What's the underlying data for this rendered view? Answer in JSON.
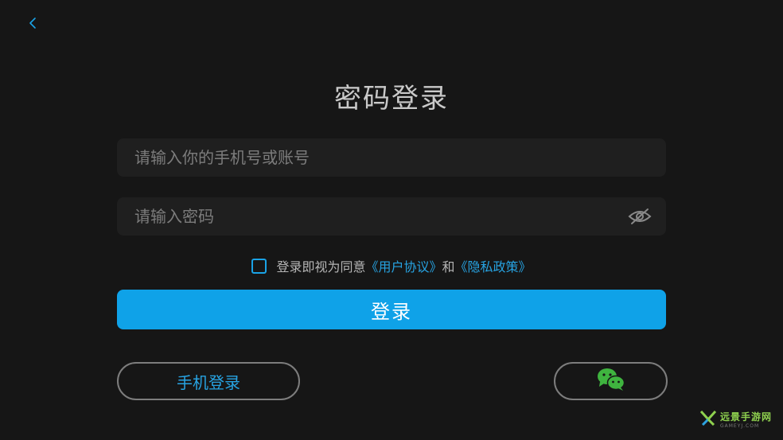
{
  "header": {
    "back_icon": "chevron-left-icon"
  },
  "title": "密码登录",
  "account_field": {
    "value": "",
    "placeholder": "请输入你的手机号或账号"
  },
  "password_field": {
    "value": "",
    "placeholder": "请输入密码",
    "toggle_icon": "eye-slash-icon"
  },
  "agreement": {
    "checked": false,
    "prefix": "登录即视为同意",
    "user_agreement": "《用户协议》",
    "conjunction": "和",
    "privacy_policy": "《隐私政策》"
  },
  "login_button": "登录",
  "phone_login_button": "手机登录",
  "wechat_button_icon": "wechat-icon",
  "watermark": {
    "name": "远景手游网",
    "sub": "GAMEYJ.COM"
  },
  "colors": {
    "background": "#161616",
    "field": "#1f1f1f",
    "accent": "#0fa2e8",
    "link": "#27a3e2",
    "wechat": "#3fb43f"
  }
}
